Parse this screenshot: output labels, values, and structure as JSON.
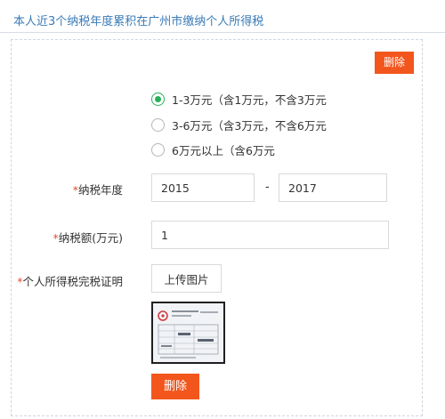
{
  "header": {
    "title": "本人近3个纳税年度累积在广州市缴纳个人所得税"
  },
  "buttons": {
    "delete_top": "删除",
    "delete_bottom": "删除",
    "upload": "上传图片"
  },
  "options": [
    {
      "label": "1-3万元（含1万元，不含3万元",
      "selected": true
    },
    {
      "label": "3-6万元（含3万元，不含6万元",
      "selected": false
    },
    {
      "label": "6万元以上（含6万元",
      "selected": false
    }
  ],
  "form": {
    "tax_year": {
      "required_mark": "*",
      "label": "纳税年度",
      "from": "2015",
      "separator": "-",
      "to": "2017"
    },
    "tax_amount": {
      "required_mark": "*",
      "label": "纳税额(万元)",
      "value": "1"
    },
    "certificate": {
      "required_mark": "*",
      "label": "个人所得税完税证明"
    }
  },
  "colors": {
    "accent_title": "#3a7bb8",
    "delete_button": "#f2561d",
    "radio_selected": "#27b05a",
    "required": "#e84a2f"
  },
  "icons": {
    "thumbnail": "tax-certificate-image"
  }
}
